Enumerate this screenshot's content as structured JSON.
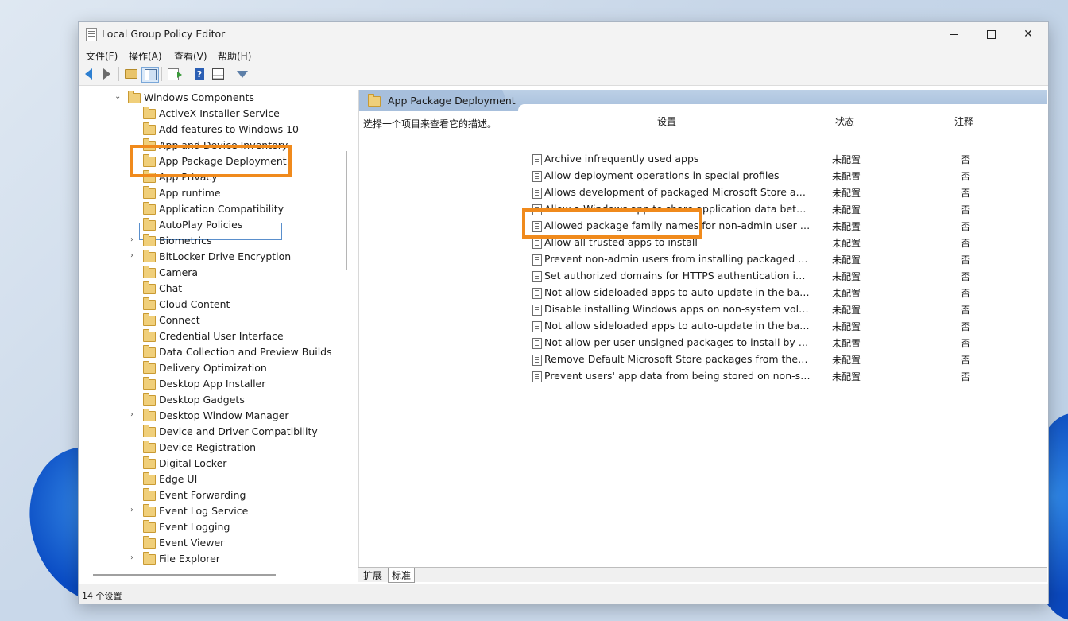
{
  "window": {
    "title": "Local Group Policy Editor"
  },
  "menu": [
    "文件(F)",
    "操作(A)",
    "查看(V)",
    "帮助(H)"
  ],
  "toolbar_icons": [
    "back-arrow-icon",
    "forward-arrow-icon",
    "up-folder-icon",
    "show-hide-tree-icon",
    "export-list-icon",
    "help-icon",
    "properties-icon",
    "filter-icon"
  ],
  "tree": {
    "parent": "Windows Components",
    "items": [
      {
        "label": "ActiveX Installer Service",
        "expandable": false
      },
      {
        "label": "Add features to Windows 10",
        "expandable": false
      },
      {
        "label": "App and Device Inventory",
        "expandable": false
      },
      {
        "label": "App Package Deployment",
        "expandable": false,
        "selected": true
      },
      {
        "label": "App Privacy",
        "expandable": false
      },
      {
        "label": "App runtime",
        "expandable": false
      },
      {
        "label": "Application Compatibility",
        "expandable": false
      },
      {
        "label": "AutoPlay Policies",
        "expandable": false
      },
      {
        "label": "Biometrics",
        "expandable": true
      },
      {
        "label": "BitLocker Drive Encryption",
        "expandable": true
      },
      {
        "label": "Camera",
        "expandable": false
      },
      {
        "label": "Chat",
        "expandable": false
      },
      {
        "label": "Cloud Content",
        "expandable": false
      },
      {
        "label": "Connect",
        "expandable": false
      },
      {
        "label": "Credential User Interface",
        "expandable": false
      },
      {
        "label": "Data Collection and Preview Builds",
        "expandable": false
      },
      {
        "label": "Delivery Optimization",
        "expandable": false
      },
      {
        "label": "Desktop App Installer",
        "expandable": false
      },
      {
        "label": "Desktop Gadgets",
        "expandable": false
      },
      {
        "label": "Desktop Window Manager",
        "expandable": true
      },
      {
        "label": "Device and Driver Compatibility",
        "expandable": false
      },
      {
        "label": "Device Registration",
        "expandable": false
      },
      {
        "label": "Digital Locker",
        "expandable": false
      },
      {
        "label": "Edge UI",
        "expandable": false
      },
      {
        "label": "Event Forwarding",
        "expandable": false
      },
      {
        "label": "Event Log Service",
        "expandable": true
      },
      {
        "label": "Event Logging",
        "expandable": false
      },
      {
        "label": "Event Viewer",
        "expandable": false
      },
      {
        "label": "File Explorer",
        "expandable": true
      }
    ]
  },
  "details": {
    "header": "App Package Deployment",
    "description": "选择一个项目来查看它的描述。",
    "columns": {
      "setting": "设置",
      "state": "状态",
      "comment": "注释"
    },
    "rows": [
      {
        "name": "Archive infrequently used apps",
        "state": "未配置",
        "comment": "否"
      },
      {
        "name": "Allow deployment operations in special profiles",
        "state": "未配置",
        "comment": "否"
      },
      {
        "name": "Allows development of packaged Microsoft Store apps and installing them from an integrated development environment (IDE)",
        "state": "未配置",
        "comment": "否"
      },
      {
        "name": "Allow a Windows app to share application data between users",
        "state": "未配置",
        "comment": "否"
      },
      {
        "name": "Allowed package family names for non-admin user installs",
        "state": "未配置",
        "comment": "否"
      },
      {
        "name": "Allow all trusted apps to install",
        "state": "未配置",
        "comment": "否",
        "highlighted": true
      },
      {
        "name": "Prevent non-admin users from installing packaged Windows apps",
        "state": "未配置",
        "comment": "否"
      },
      {
        "name": "Set authorized domains for HTTPS authentication in MSIX",
        "state": "未配置",
        "comment": "否"
      },
      {
        "name": "Not allow sideloaded apps to auto-update in the background",
        "state": "未配置",
        "comment": "否"
      },
      {
        "name": "Disable installing Windows apps on non-system volumes",
        "state": "未配置",
        "comment": "否"
      },
      {
        "name": "Not allow sideloaded apps to auto-update in the background on a metered network",
        "state": "未配置",
        "comment": "否"
      },
      {
        "name": "Not allow per-user unsigned packages to install by default",
        "state": "未配置",
        "comment": "否"
      },
      {
        "name": "Remove Default Microsoft Store packages from the system",
        "state": "未配置",
        "comment": "否"
      },
      {
        "name": "Prevent users' app data from being stored on non-system volumes",
        "state": "未配置",
        "comment": "否"
      }
    ]
  },
  "bottom_tabs": [
    "扩展",
    "标准"
  ],
  "status": {
    "text": "14 个设置"
  },
  "colors": {
    "highlight": "#f08a1c",
    "header": "#a7bfdc"
  }
}
